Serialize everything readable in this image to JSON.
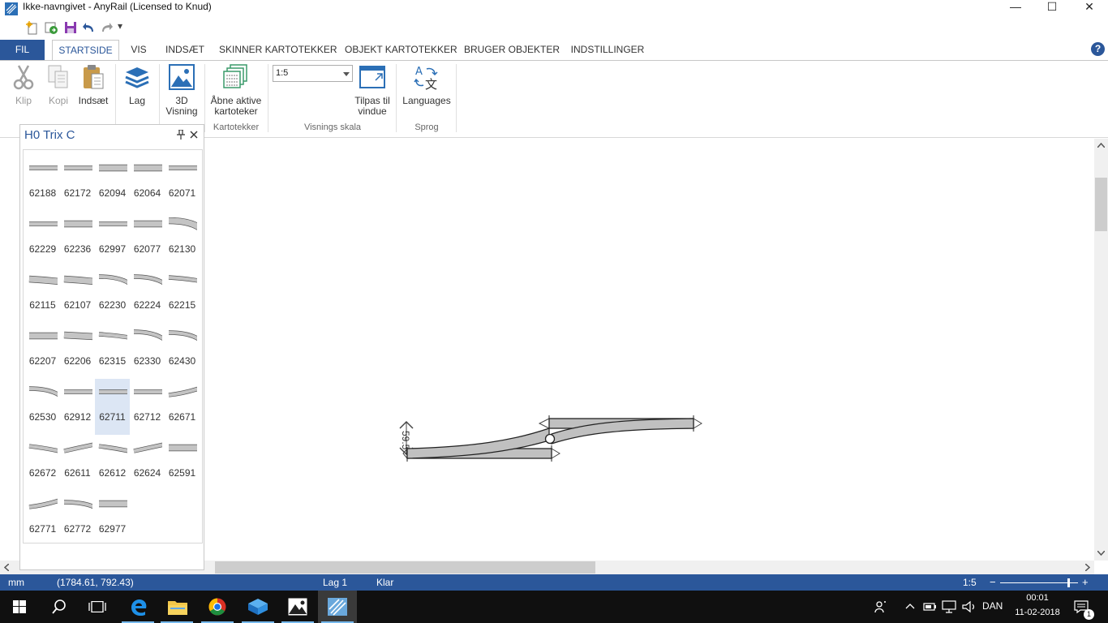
{
  "window": {
    "title": "Ikke-navngivet - AnyRail (Licensed to Knud)",
    "controls": [
      "—",
      "☐",
      "✕"
    ]
  },
  "qat": {
    "dropdown": "▾"
  },
  "tabs": [
    {
      "label": "FIL"
    },
    {
      "label": "STARTSIDE"
    },
    {
      "label": "VIS"
    },
    {
      "label": "INDSÆT"
    },
    {
      "label": "SKINNER KARTOTEKKER"
    },
    {
      "label": "OBJEKT KARTOTEKKER"
    },
    {
      "label": "BRUGER OBJEKTER"
    },
    {
      "label": "INDSTILLINGER"
    }
  ],
  "help": "?",
  "ribbon": {
    "clip": "Klip",
    "copy": "Kopi",
    "paste": "Indsæt",
    "layer": "Lag",
    "view3d_1": "3D",
    "view3d_2": "Visning",
    "open_catalogs_1": "Åbne aktive",
    "open_catalogs_2": "kartoteker",
    "group_catalogs": "Kartotekker",
    "scale_value": "1:5",
    "fit_1": "Tilpas til",
    "fit_2": "vindue",
    "group_scale": "Visnings skala",
    "languages": "Languages",
    "group_language": "Sprog"
  },
  "panel": {
    "title": "H0 Trix C",
    "pin": "⊥",
    "close": "✕",
    "selected": "62711",
    "parts": [
      "62188",
      "62172",
      "62094",
      "62064",
      "62071",
      "62229",
      "62236",
      "62997",
      "62077",
      "62130",
      "62115",
      "62107",
      "62230",
      "62224",
      "62215",
      "62207",
      "62206",
      "62315",
      "62330",
      "62430",
      "62530",
      "62912",
      "62711",
      "62712",
      "62671",
      "62672",
      "62611",
      "62612",
      "62624",
      "62591",
      "62771",
      "62772",
      "62977"
    ]
  },
  "canvas": {
    "dimension": "59.5"
  },
  "status": {
    "unit": "mm",
    "coords": "(1784.61, 792.43)",
    "layer": "Lag 1",
    "state": "Klar",
    "zoom": "1:5",
    "zoom_level": 0.88
  },
  "taskbar": {
    "lang": "DAN",
    "time": "00:01",
    "date": "11-02-2018",
    "notif_count": "1"
  }
}
